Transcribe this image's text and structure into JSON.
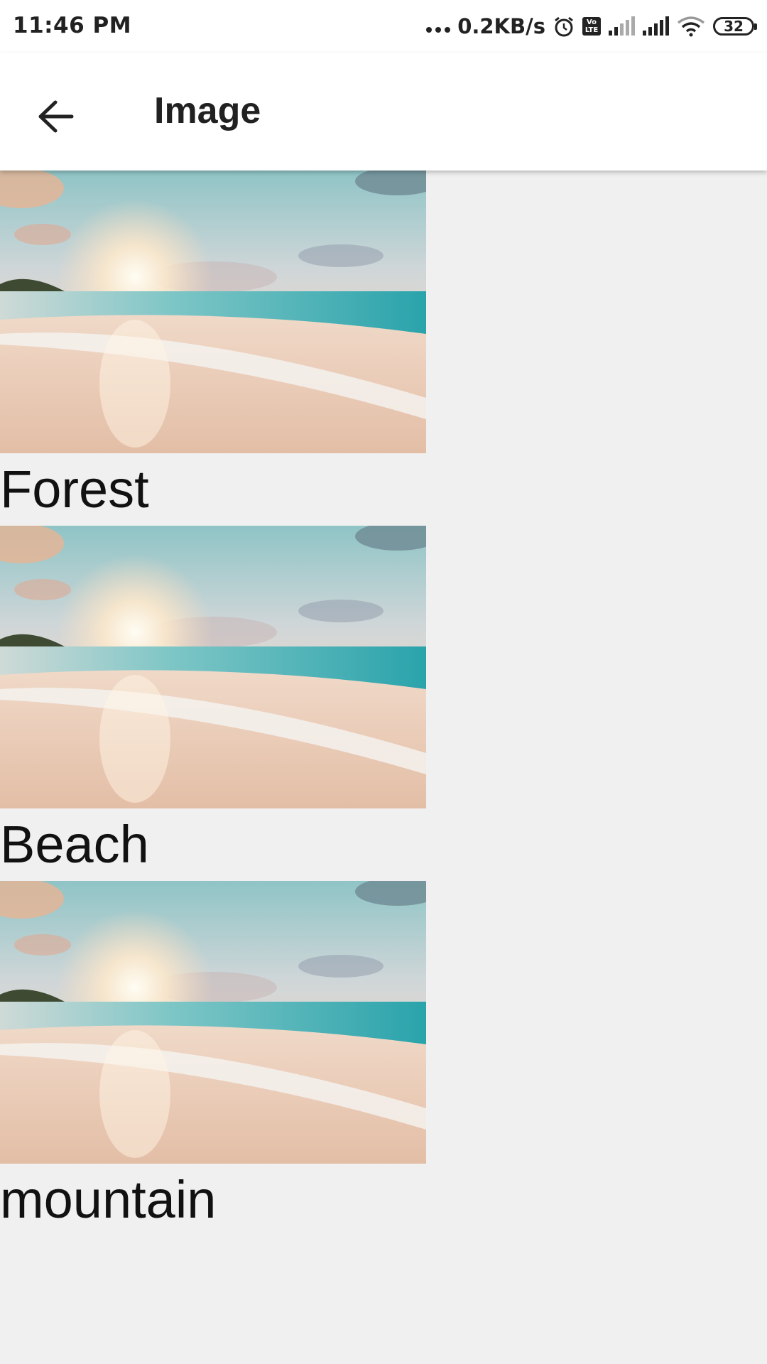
{
  "status_bar": {
    "time": "11:46 PM",
    "net_speed": "0.2KB/s",
    "volte_top": "Vo",
    "volte_bottom": "LTE",
    "battery": "32",
    "icons": [
      "alarm-icon",
      "volte-icon",
      "signal-icon",
      "signal-icon",
      "wifi-icon",
      "battery-icon"
    ]
  },
  "app_bar": {
    "title": "Image",
    "back_icon": "arrow-back-icon"
  },
  "items": [
    {
      "label": "Forest",
      "image": "beach-sunset"
    },
    {
      "label": "Beach",
      "image": "beach-sunset"
    },
    {
      "label": "mountain",
      "image": "beach-sunset"
    }
  ]
}
